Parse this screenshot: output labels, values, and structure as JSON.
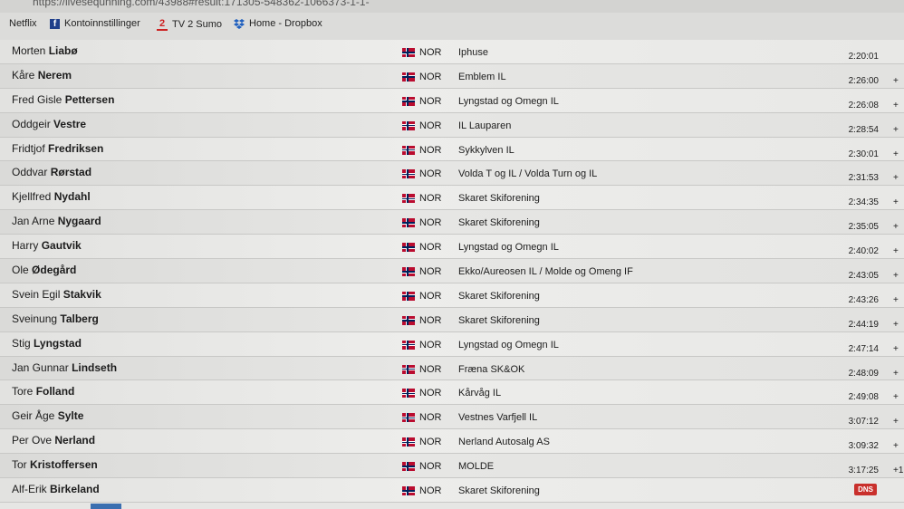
{
  "browser": {
    "url": "https://livesequnning.com/43988#result:171305-548362-1066373-1-1-",
    "bookmarks": [
      {
        "label": "Netflix",
        "icon": ""
      },
      {
        "label": "Kontoinnstillinger",
        "icon": "facebook-icon"
      },
      {
        "label": "TV 2 Sumo",
        "icon": "tv2-icon"
      },
      {
        "label": "Home - Dropbox",
        "icon": "dropbox-icon"
      }
    ]
  },
  "results": [
    {
      "first": "Morten",
      "last": "Liabø",
      "nation": "NOR",
      "club": "Iphuse",
      "time": "2:20:01",
      "diff": ""
    },
    {
      "first": "Kåre",
      "last": "Nerem",
      "nation": "NOR",
      "club": "Emblem IL",
      "time": "2:26:00",
      "diff": "+"
    },
    {
      "first": "Fred Gisle",
      "last": "Pettersen",
      "nation": "NOR",
      "club": "Lyngstad og Omegn IL",
      "time": "2:26:08",
      "diff": "+"
    },
    {
      "first": "Oddgeir",
      "last": "Vestre",
      "nation": "NOR",
      "club": "IL Lauparen",
      "time": "2:28:54",
      "diff": "+"
    },
    {
      "first": "Fridtjof",
      "last": "Fredriksen",
      "nation": "NOR",
      "club": "Sykkylven IL",
      "time": "2:30:01",
      "diff": "+"
    },
    {
      "first": "Oddvar",
      "last": "Rørstad",
      "nation": "NOR",
      "club": "Volda T og IL / Volda Turn og IL",
      "time": "2:31:53",
      "diff": "+"
    },
    {
      "first": "Kjellfred",
      "last": "Nydahl",
      "nation": "NOR",
      "club": "Skaret Skiforening",
      "time": "2:34:35",
      "diff": "+"
    },
    {
      "first": "Jan Arne",
      "last": "Nygaard",
      "nation": "NOR",
      "club": "Skaret Skiforening",
      "time": "2:35:05",
      "diff": "+"
    },
    {
      "first": "Harry",
      "last": "Gautvik",
      "nation": "NOR",
      "club": "Lyngstad og Omegn IL",
      "time": "2:40:02",
      "diff": "+"
    },
    {
      "first": "Ole",
      "last": "Ødegård",
      "nation": "NOR",
      "club": "Ekko/Aureosen IL / Molde og Omeng IF",
      "time": "2:43:05",
      "diff": "+"
    },
    {
      "first": "Svein Egil",
      "last": "Stakvik",
      "nation": "NOR",
      "club": "Skaret Skiforening",
      "time": "2:43:26",
      "diff": "+"
    },
    {
      "first": "Sveinung",
      "last": "Talberg",
      "nation": "NOR",
      "club": "Skaret Skiforening",
      "time": "2:44:19",
      "diff": "+"
    },
    {
      "first": "Stig",
      "last": "Lyngstad",
      "nation": "NOR",
      "club": "Lyngstad og Omegn IL",
      "time": "2:47:14",
      "diff": "+"
    },
    {
      "first": "Jan Gunnar",
      "last": "Lindseth",
      "nation": "NOR",
      "club": "Fræna SK&OK",
      "time": "2:48:09",
      "diff": "+"
    },
    {
      "first": "Tore",
      "last": "Folland",
      "nation": "NOR",
      "club": "Kårvåg IL",
      "time": "2:49:08",
      "diff": "+"
    },
    {
      "first": "Geir Åge",
      "last": "Sylte",
      "nation": "NOR",
      "club": "Vestnes Varfjell IL",
      "time": "3:07:12",
      "diff": "+"
    },
    {
      "first": "Per Ove",
      "last": "Nerland",
      "nation": "NOR",
      "club": "Nerland Autosalg AS",
      "time": "3:09:32",
      "diff": "+"
    },
    {
      "first": "Tor",
      "last": "Kristoffersen",
      "nation": "NOR",
      "club": "MOLDE",
      "time": "3:17:25",
      "diff": "+1"
    },
    {
      "first": "Alf-Erik",
      "last": "Birkeland",
      "nation": "NOR",
      "club": "Skaret Skiforening",
      "time": "",
      "diff": "",
      "status": "DNS"
    }
  ]
}
